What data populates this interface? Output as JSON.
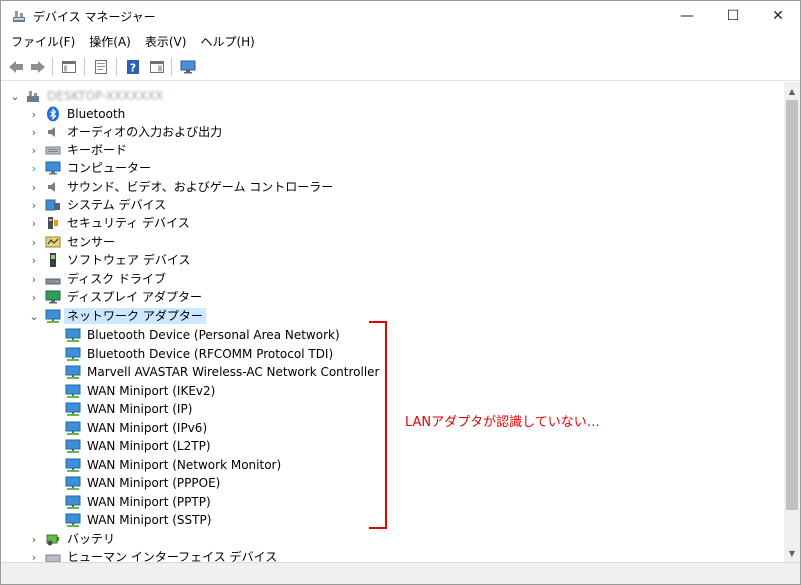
{
  "window": {
    "title": "デバイス マネージャー",
    "controls": {
      "minimize": "—",
      "maximize": "☐",
      "close": "✕"
    }
  },
  "menu": [
    {
      "label": "ファイル(F)"
    },
    {
      "label": "操作(A)"
    },
    {
      "label": "表示(V)"
    },
    {
      "label": "ヘルプ(H)"
    }
  ],
  "toolbar": [
    {
      "icon": "back-arrow-icon"
    },
    {
      "icon": "forward-arrow-icon"
    },
    {
      "icon": "tree-view-icon"
    },
    {
      "icon": "properties-icon"
    },
    {
      "icon": "help-icon"
    },
    {
      "icon": "action-pane-icon"
    },
    {
      "icon": "display-monitor-icon"
    }
  ],
  "tree": {
    "root_label": "DESKTOP-XXXXXXX",
    "categories": [
      {
        "label": "Bluetooth",
        "icon": "bluetooth-icon"
      },
      {
        "label": "オーディオの入力および出力",
        "icon": "speaker-icon"
      },
      {
        "label": "キーボード",
        "icon": "keyboard-icon"
      },
      {
        "label": "コンピューター",
        "icon": "computer-icon"
      },
      {
        "label": "サウンド、ビデオ、およびゲーム コントローラー",
        "icon": "speaker-icon"
      },
      {
        "label": "システム デバイス",
        "icon": "system-device-icon"
      },
      {
        "label": "セキュリティ デバイス",
        "icon": "security-icon"
      },
      {
        "label": "センサー",
        "icon": "sensor-icon"
      },
      {
        "label": "ソフトウェア デバイス",
        "icon": "software-device-icon"
      },
      {
        "label": "ディスク ドライブ",
        "icon": "disk-drive-icon"
      },
      {
        "label": "ディスプレイ アダプター",
        "icon": "display-adapter-icon"
      },
      {
        "label": "ネットワーク アダプター",
        "icon": "network-adapter-icon",
        "expanded": true,
        "selected": true
      }
    ],
    "network_adapters": [
      "Bluetooth Device (Personal Area Network)",
      "Bluetooth Device (RFCOMM Protocol TDI)",
      "Marvell AVASTAR Wireless-AC Network Controller",
      "WAN Miniport (IKEv2)",
      "WAN Miniport (IP)",
      "WAN Miniport (IPv6)",
      "WAN Miniport (L2TP)",
      "WAN Miniport (Network Monitor)",
      "WAN Miniport (PPPOE)",
      "WAN Miniport (PPTP)",
      "WAN Miniport (SSTP)"
    ],
    "after": [
      {
        "label": "バッテリ",
        "icon": "battery-icon"
      },
      {
        "label": "ヒューマン インターフェイス デバイス",
        "icon": "hid-icon"
      }
    ]
  },
  "annotation": {
    "text": "LANアダプタが認識していない…",
    "color": "#e60000"
  },
  "colors": {
    "selection": "#cce8ff",
    "accent": "#e60000"
  }
}
